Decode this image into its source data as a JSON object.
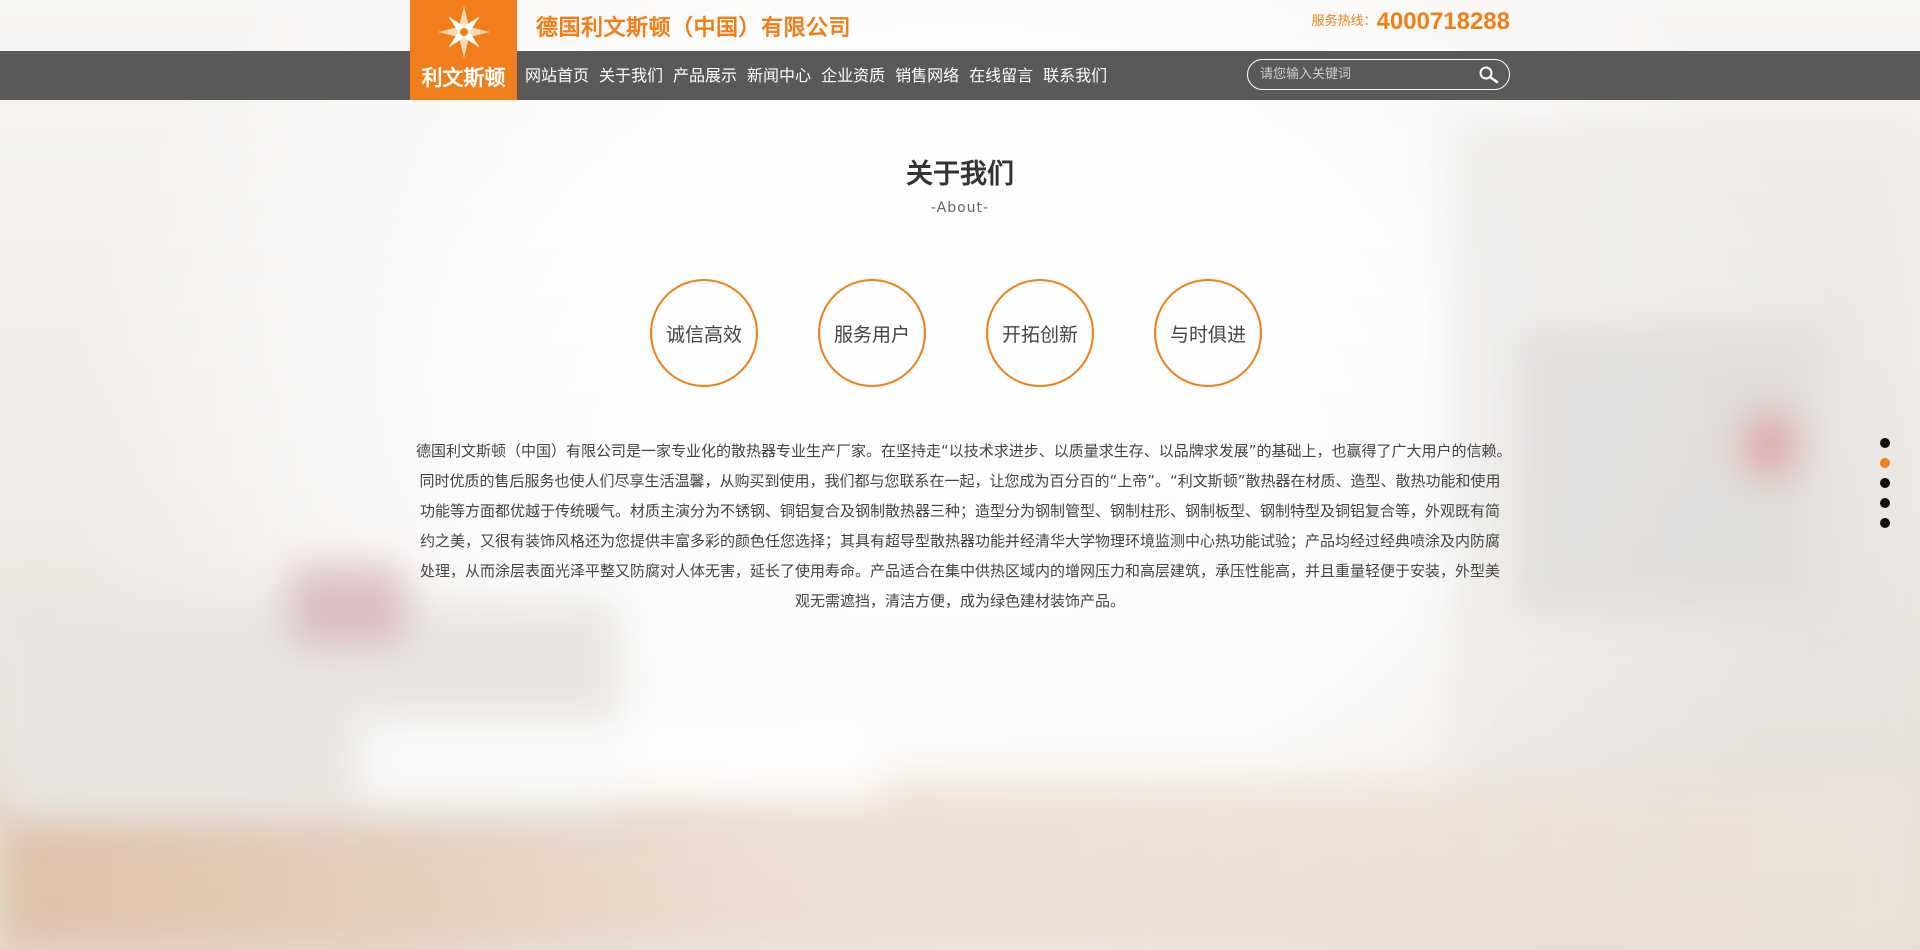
{
  "header": {
    "logo_text": "利文斯顿",
    "company_name": "德国利文斯顿（中国）有限公司",
    "hotline_label": "服务热线：",
    "hotline_number": "4000718288"
  },
  "nav": {
    "items": [
      {
        "label": "网站首页"
      },
      {
        "label": "关于我们"
      },
      {
        "label": "产品展示"
      },
      {
        "label": "新闻中心"
      },
      {
        "label": "企业资质"
      },
      {
        "label": "销售网络"
      },
      {
        "label": "在线留言"
      },
      {
        "label": "联系我们"
      }
    ]
  },
  "search": {
    "placeholder": "请您输入关键词",
    "value": ""
  },
  "about": {
    "title": "关于我们",
    "subtitle": "-About-",
    "values": [
      "诚信高效",
      "服务用户",
      "开拓创新",
      "与时俱进"
    ],
    "intro": "德国利文斯顿（中国）有限公司是一家专业化的散热器专业生产厂家。在坚持走“以技术求进步、以质量求生存、以品牌求发展”的基础上，也赢得了广大用户的信赖。　　同时优质的售后服务也使人们尽享生活温馨，从购买到使用，我们都与您联系在一起，让您成为百分百的“上帝”。“利文斯顿”散热器在材质、造型、散热功能和使用功能等方面都优越于传统暖气。材质主演分为不锈钢、铜铝复合及钢制散热器三种；造型分为钢制管型、钢制柱形、钢制板型、钢制特型及铜铝复合等，外观既有简约之美，又很有装饰风格还为您提供丰富多彩的颜色任您选择；其具有超导型散热器功能并经清华大学物理环境监测中心热功能试验；产品均经过经典喷涂及内防腐处理，从而涂层表面光泽平整又防腐对人体无害，延长了使用寿命。产品适合在集中供热区域内的增网压力和高层建筑，承压性能高，并且重量轻便于安装，外型美观无需遮挡，清洁方便，成为绿色建材装饰产品。"
  },
  "pager": {
    "count": 5,
    "active_index": 1
  },
  "colors": {
    "accent": "#f07f1b",
    "nav_bg": "#5a5958",
    "dot": "#111111"
  },
  "icons": {
    "logo": "star-burst-icon",
    "search": "search-icon"
  }
}
